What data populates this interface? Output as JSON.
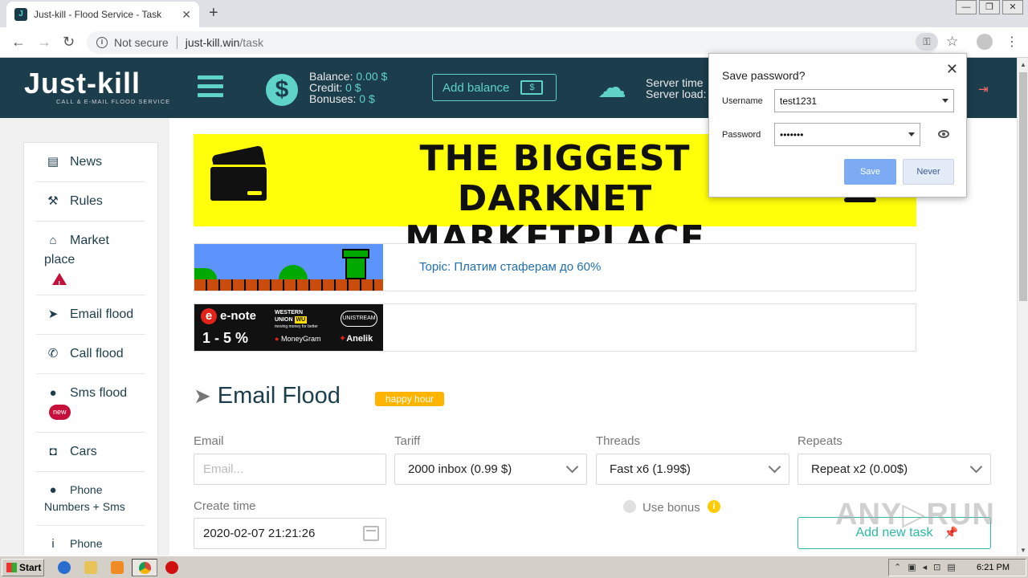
{
  "browser": {
    "tab_title": "Just-kill - Flood Service - Task",
    "tab_close": "✕",
    "new_tab": "+",
    "security_label": "Not secure",
    "url_domain": "just-kill.win",
    "url_path": "/task",
    "window_controls": [
      "—",
      "❐",
      "✕"
    ]
  },
  "header": {
    "logo_main": "Just-kill",
    "logo_sub": "CALL & E-MAIL FLOOD SERVICE",
    "balance_label": "Balance:",
    "balance_value": "0.00 $",
    "credit_label": "Credit:",
    "credit_value": "0 $",
    "bonuses_label": "Bonuses:",
    "bonuses_value": "0 $",
    "add_balance": "Add balance",
    "server_time_label": "Server time",
    "server_load_label": "Server load:"
  },
  "sidebar": {
    "items": [
      {
        "label": "News",
        "icon": "newspaper-icon",
        "glyph": "▤"
      },
      {
        "label": "Rules",
        "icon": "gavel-icon",
        "glyph": "⚒"
      },
      {
        "label": "Market place",
        "icon": "basket-icon",
        "glyph": "⌂"
      },
      {
        "label": "Email flood",
        "icon": "paper-plane-icon",
        "glyph": "➤"
      },
      {
        "label": "Call flood",
        "icon": "phone-icon",
        "glyph": "✆"
      },
      {
        "label": "Sms flood",
        "icon": "chat-icon",
        "glyph": "●"
      },
      {
        "label": "Cars",
        "icon": "car-icon",
        "glyph": "◘"
      },
      {
        "label": "Phone Numbers + Sms",
        "icon": "chat-icon",
        "glyph": "●"
      },
      {
        "label": "Phone",
        "icon": "info-icon",
        "glyph": "i"
      }
    ],
    "new_badge": "new"
  },
  "banners": {
    "yellow_line1": "THE BIGGEST",
    "yellow_line2": "DARKNET MARKETPLACE",
    "topic": "Topic: Платим стаферам до 60%",
    "enote_name": "e-note",
    "enote_pct": "1 - 5 %",
    "western_union_line1": "WESTERN",
    "western_union_line2": "UNION",
    "western_union_badge": "WU",
    "western_union_tagline": "moving money for better",
    "unistream": "UNISTREAM",
    "moneygram": "MoneyGram",
    "anelik": "Anelik"
  },
  "form": {
    "title": "Email Flood",
    "happy_hour": "happy hour",
    "email_label": "Email",
    "email_placeholder": "Email...",
    "tariff_label": "Tariff",
    "tariff_value": "2000 inbox (0.99 $)",
    "threads_label": "Threads",
    "threads_value": "Fast x6 (1.99$)",
    "repeats_label": "Repeats",
    "repeats_value": "Repeat x2 (0.00$)",
    "create_time_label": "Create time",
    "create_time_value": "2020-02-07 21:21:26",
    "use_bonus_label": "Use bonus",
    "info_glyph": "i",
    "add_task": "Add new task"
  },
  "password_dialog": {
    "title": "Save password?",
    "username_label": "Username",
    "username_value": "test1231",
    "password_label": "Password",
    "password_value": "•••••••",
    "save": "Save",
    "never": "Never",
    "close": "✕"
  },
  "watermark": "ANY▷RUN",
  "taskbar": {
    "start": "Start",
    "clock": "6:21 PM"
  },
  "colors": {
    "header_bg": "#1c3d4c",
    "accent": "#5fd3c7",
    "happy_hour": "#ffb400",
    "banner_yellow": "#ffff0a",
    "save_button": "#7cabf4"
  }
}
